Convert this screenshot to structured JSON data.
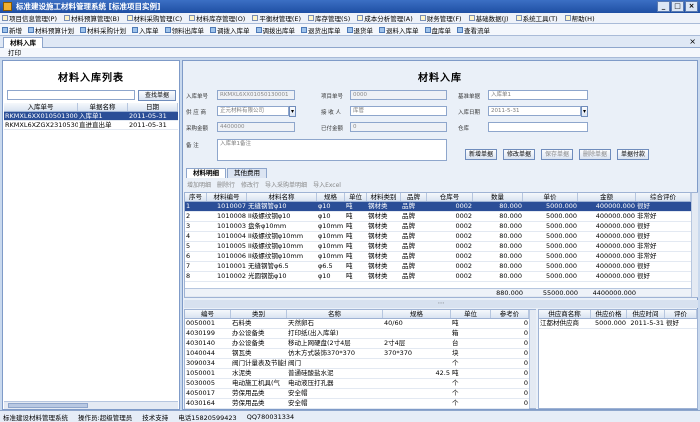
{
  "window": {
    "title": "标准建设施工材料管理系统 [标准项目实例]",
    "min": "_",
    "max": "□",
    "close": "×"
  },
  "menu": [
    "项目信息管理(P)",
    "材料预算管理(B)",
    "材料采购管理(C)",
    "材料库存管理(O)",
    "平衡材管理(E)",
    "库存管理(S)",
    "成本分析管理(A)",
    "财务管理(F)",
    "基础数据(J)",
    "系统工具(T)",
    "帮助(H)"
  ],
  "toolbar": [
    "新增",
    "材料预算计划",
    "材料采购计划",
    "入库单",
    "领料出库单",
    "调拨入库单",
    "调拨出库单",
    "退货出库单",
    "退货单",
    "退料入库单",
    "盘库单",
    "查看流单"
  ],
  "doc_tab": {
    "label": "材料入库",
    "close": "×"
  },
  "subbar": {
    "print": "打印"
  },
  "left": {
    "title": "材料入库列表",
    "search_button": "查找单据",
    "columns": [
      "入库单号",
      "单据名称",
      "日期"
    ],
    "rows": [
      {
        "no": "RKMXL6XX01050130001",
        "name": "入库单1",
        "date": "2011-05-31",
        "selected": true
      },
      {
        "no": "RKMXL6XZGX23105301001_R",
        "name": "直进直出单",
        "date": "2011-05-31",
        "selected": false
      }
    ]
  },
  "form": {
    "title": "材料入库",
    "labels": {
      "order_no": "入库单号",
      "order_name": "单据名称",
      "supplier": "供 应 商",
      "amount": "采购金额",
      "remark": "备 注",
      "project_no": "项目单号",
      "receiver": "接 收 人",
      "paid": "已付金额",
      "reserve": "入库日期",
      "reference": "基准单据",
      "freight": "运费金额",
      "warehouse": "仓库"
    },
    "values": {
      "order_no": "RKMXL6XX01050130001",
      "project_no": "0000",
      "order_name": "入库单1",
      "supplier": "正元材料有限公司",
      "receiver": "库管",
      "date": "2011-5-31",
      "amount": "4400000",
      "paid": "0",
      "remark": "入库单1备注"
    },
    "buttons": {
      "add": "新增单据",
      "modify": "修改单据",
      "save": "保存单据",
      "delete": "删除单据",
      "pay": "单据付款"
    }
  },
  "detail_tabs": [
    "材料明细",
    "其他费用"
  ],
  "detail_toolbar": [
    "增加明细",
    "删除行",
    "修改行",
    "导入采购单明细",
    "导入Excel"
  ],
  "detail_grid": {
    "columns": [
      "序号",
      "材料编号",
      "材料名称",
      "规格",
      "单位",
      "材料类别",
      "品牌",
      "仓库号",
      "数量",
      "单价",
      "金额",
      "综合评价"
    ],
    "rows": [
      [
        "1",
        "1010007",
        "无缝钢管φ10",
        "φ10",
        "吨",
        "钢材类",
        "品牌",
        "0002",
        "80.000",
        "5000.000",
        "400000.000",
        "很好"
      ],
      [
        "2",
        "1010008",
        "II级螺纹钢φ10",
        "φ10",
        "吨",
        "钢材类",
        "品牌",
        "0002",
        "80.000",
        "5000.000",
        "400000.000",
        "非常好"
      ],
      [
        "3",
        "1010003",
        "盘条φ10mm",
        "φ10mm",
        "吨",
        "钢材类",
        "品牌",
        "0002",
        "80.000",
        "5000.000",
        "400000.000",
        "很好"
      ],
      [
        "4",
        "1010004",
        "II级螺纹钢φ10mm",
        "φ10mm",
        "吨",
        "钢材类",
        "品牌",
        "0002",
        "80.000",
        "5000.000",
        "400000.000",
        "很好"
      ],
      [
        "5",
        "1010005",
        "II级螺纹钢φ10mm",
        "φ10mm",
        "吨",
        "钢材类",
        "品牌",
        "0002",
        "80.000",
        "5000.000",
        "400000.000",
        "非常好"
      ],
      [
        "6",
        "1010006",
        "II级螺纹钢φ10mm",
        "φ10mm",
        "吨",
        "钢材类",
        "品牌",
        "0002",
        "80.000",
        "5000.000",
        "400000.000",
        "非常好"
      ],
      [
        "7",
        "1010001",
        "无缝钢管φ6.5",
        "φ6.5",
        "吨",
        "钢材类",
        "品牌",
        "0002",
        "80.000",
        "5000.000",
        "400000.000",
        "很好"
      ],
      [
        "8",
        "1010002",
        "光圆钢筋φ10",
        "φ10",
        "吨",
        "钢材类",
        "品牌",
        "0002",
        "80.000",
        "5000.000",
        "400000.000",
        "很好"
      ]
    ],
    "totals": {
      "qty": "880.000",
      "price": "55000.000",
      "amount": "4400000.000"
    }
  },
  "material_grid": {
    "columns": [
      "编号",
      "类别",
      "名称",
      "规格",
      "单位",
      "参考价"
    ],
    "rows": [
      [
        "0050001",
        "石料类",
        "天然卵石",
        "40/60",
        "吨",
        "0"
      ],
      [
        "4030199",
        "办公设备类",
        "打印纸(出入库单)",
        "",
        "箱",
        "0"
      ],
      [
        "4030140",
        "办公设备类",
        "移动上网硬盘(2寸4层",
        "2寸4层",
        "台",
        "0"
      ],
      [
        "1040044",
        "钢瓦类",
        "仿木方式装饰370*370",
        "370*370",
        "块",
        "0"
      ],
      [
        "3090034",
        "阀门计量表及节能技术",
        "阀门",
        "",
        "个",
        "0"
      ],
      [
        "1050001",
        "水泥类",
        "普通硅酸盐水泥",
        "42.5",
        "吨",
        "0"
      ],
      [
        "5030005",
        "电动施工机具(气",
        "电动液压打孔器",
        "",
        "个",
        "0"
      ],
      [
        "4050017",
        "劳保用品类",
        "安全帽",
        "",
        "个",
        "0"
      ],
      [
        "4030164",
        "劳保用品类",
        "安全帽",
        "",
        "个",
        "0"
      ]
    ]
  },
  "supplier_grid": {
    "columns": [
      "供应商名称",
      "供应价格",
      "供应时间",
      "评价"
    ],
    "rows": [
      [
        "江都材供应商",
        "5000.000",
        "2011-5-31",
        "很好"
      ]
    ]
  },
  "status": [
    "标准建设材料管理系统",
    "操作员:超级管理员",
    "技术支持",
    "电话15820599423",
    "QQ780031334"
  ]
}
